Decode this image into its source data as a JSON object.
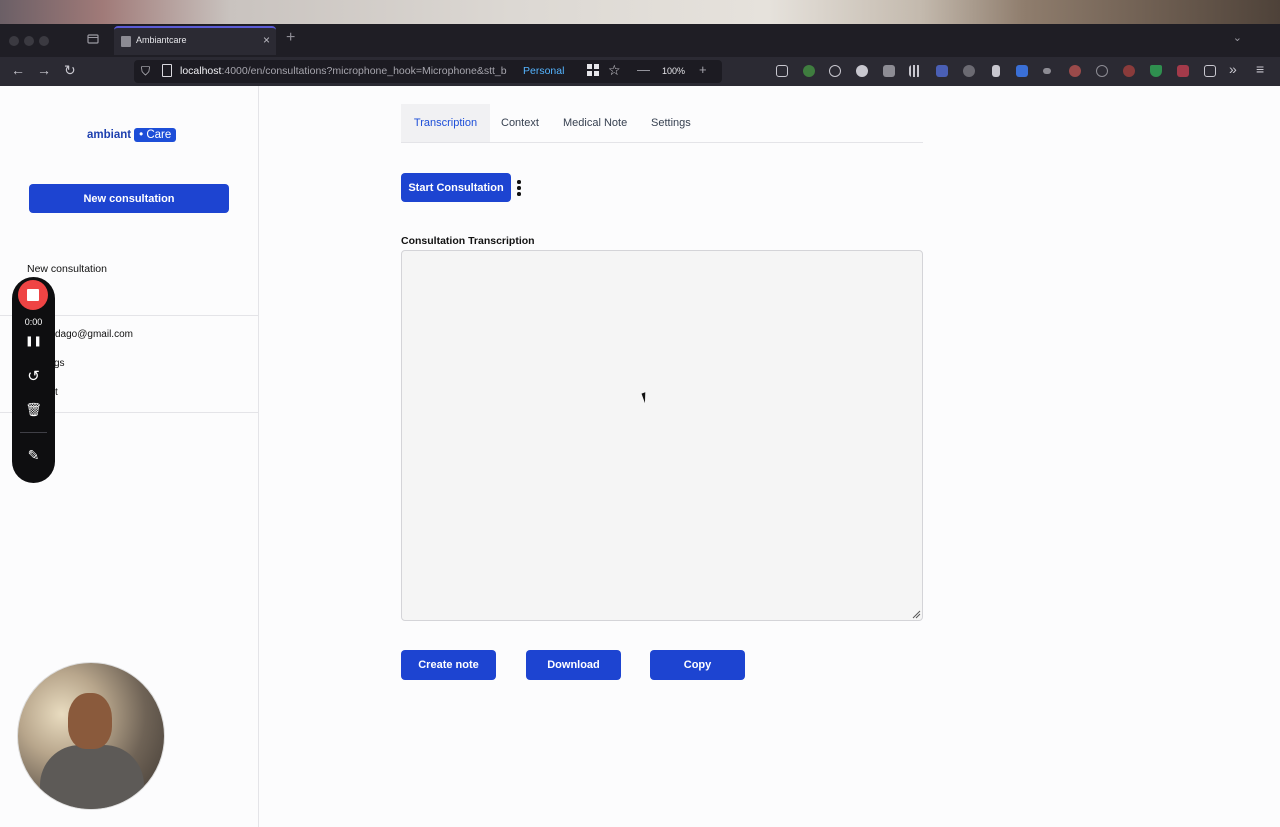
{
  "browser": {
    "tab_title": "Ambiantcare",
    "tab_close": "×",
    "new_tab": "+",
    "url_host": "localhost",
    "url_rest": ":4000/en/consultations?microphone_hook=Microphone&stt_b",
    "profile": "Personal",
    "zoom": "100%",
    "zoom_minus": "—",
    "zoom_plus": "+",
    "tab_list": "⌄",
    "nav_back": "←",
    "nav_forward": "→",
    "nav_reload": "↻",
    "shield": "⛉",
    "star": "☆",
    "overflow": "»",
    "menu": "≡"
  },
  "sidebar": {
    "logo_text": "ambiant",
    "logo_badge": "• Care",
    "new_button": "New consultation",
    "items": [
      {
        "label": "New consultation"
      }
    ],
    "account": {
      "email_partial": "dago@gmail.com",
      "settings_partial": "gs",
      "logout_partial": "t"
    }
  },
  "tabs": [
    {
      "label": "Transcription",
      "active": true
    },
    {
      "label": "Context",
      "active": false
    },
    {
      "label": "Medical Note",
      "active": false
    },
    {
      "label": "Settings",
      "active": false
    }
  ],
  "main": {
    "start_button": "Start Consultation",
    "transcription_label": "Consultation Transcription",
    "transcription_value": "",
    "actions": {
      "create": "Create note",
      "download": "Download",
      "copy": "Copy"
    }
  },
  "recorder": {
    "time": "0:00",
    "pause_icon": "❚❚",
    "restart_icon": "↺",
    "delete_icon": "🗑",
    "draw_icon": "✎"
  },
  "colors": {
    "primary": "#1d44d1",
    "active_tab": "#1d4ed8",
    "record": "#ef4444"
  }
}
